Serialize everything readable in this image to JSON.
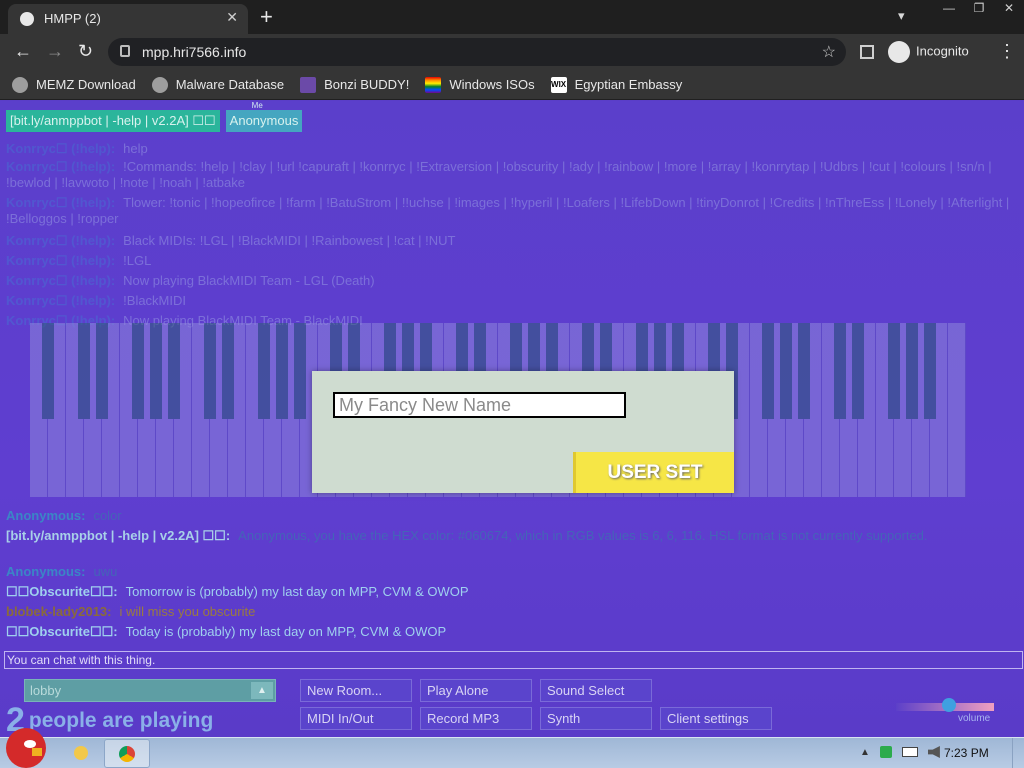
{
  "browser": {
    "tab_title": "HMPP (2)",
    "tab_close": "✕",
    "new_tab": "+",
    "url": "mpp.hri7566.info",
    "incognito_label": "Incognito",
    "window_controls": [
      "—",
      "❐",
      "✕"
    ]
  },
  "bookmarks": [
    {
      "label": "MEMZ Download",
      "icon": "globe-icon"
    },
    {
      "label": "Malware Database",
      "icon": "globe-icon"
    },
    {
      "label": "Bonzi BUDDY!",
      "icon": "bonzi-icon"
    },
    {
      "label": "Windows ISOs",
      "icon": "rainbow-flag-icon"
    },
    {
      "label": "Egyptian Embassy",
      "icon": "wix-icon"
    }
  ],
  "namebar": {
    "bot_tag": "[bit.ly/anmppbot | -help | v2.2A] ☐☐",
    "me_label": "Me",
    "user_tag": "Anonymous"
  },
  "chat": {
    "messages": [
      {
        "who": "Konrryc☐ (!help):",
        "text": "help"
      },
      {
        "who": "Konrryc☐ (!help):",
        "text": "!Commands: !help | !clay | !url !capuraft | !konrryc | !Extraversion | !obscurity | !ady | !rainbow | !more | !array | !konrrytap | !Udbrs | !cut | !colours | !sn/n | !bewlod | !lavwoto | !note | !noah | !atbake"
      },
      {
        "who": "Konrryc☐ (!help):",
        "text": "Tlower: !tonic | !hopeofirce | !farm | !BatuStrom | !!uchse | !images | !hyperil | !Loafers | !LifebDown | !tinyDonrot | !Credits | !nThreEss | !Lonely | !Afterlight | !Belloggos | !ropper"
      },
      {
        "who": "Konrryc☐ (!help):",
        "text": "Black MIDIs: !LGL | !BlackMIDI | !Rainbowest | !cat | !NUT"
      },
      {
        "who": "Konrryc☐ (!help):",
        "text": "!LGL"
      },
      {
        "who": "Konrryc☐ (!help):",
        "text": "Now playing BlackMIDI Team - LGL (Death)"
      },
      {
        "who": "Konrryc☐ (!help):",
        "text": "!BlackMIDI"
      },
      {
        "who": "Konrryc☐ (!help):",
        "text": "Now playing BlackMIDI Team - BlackMIDI"
      },
      {
        "who": "Anonymous:",
        "text": "color"
      },
      {
        "who": "[bit.ly/anmppbot | -help | v2.2A] ☐☐:",
        "text": "Anonymous, you have the HEX color: #060674, which in RGB values is 6, 6, 116. HSL format is not currently supported."
      },
      {
        "who": "Anonymous:",
        "text": "uwu"
      },
      {
        "who": "☐☐Obscurite☐☐:",
        "text": "Tomorrow is (probably) my last day on MPP, CVM & OWOP"
      },
      {
        "who": "blobek-lady2013:",
        "text": "i will miss you obscurite"
      },
      {
        "who": "☐☐Obscurite☐☐:",
        "text": "Today is (probably) my last day on MPP, CVM & OWOP"
      }
    ]
  },
  "modal": {
    "name_placeholder": "My Fancy New Name",
    "submit_label": "USER SET"
  },
  "chat_input_placeholder": "You can chat with this thing.",
  "room": {
    "name": "lobby",
    "player_count": "2",
    "players_label": "people are playing"
  },
  "controls": {
    "new_room": "New Room...",
    "play_alone": "Play Alone",
    "sound_select": "Sound Select",
    "midi_in_out": "MIDI In/Out",
    "record_mp3": "Record MP3",
    "synth": "Synth",
    "client_settings": "Client settings",
    "volume_label": "volume",
    "volume_level": 0.55
  },
  "taskbar": {
    "clock": "7:23 PM"
  }
}
